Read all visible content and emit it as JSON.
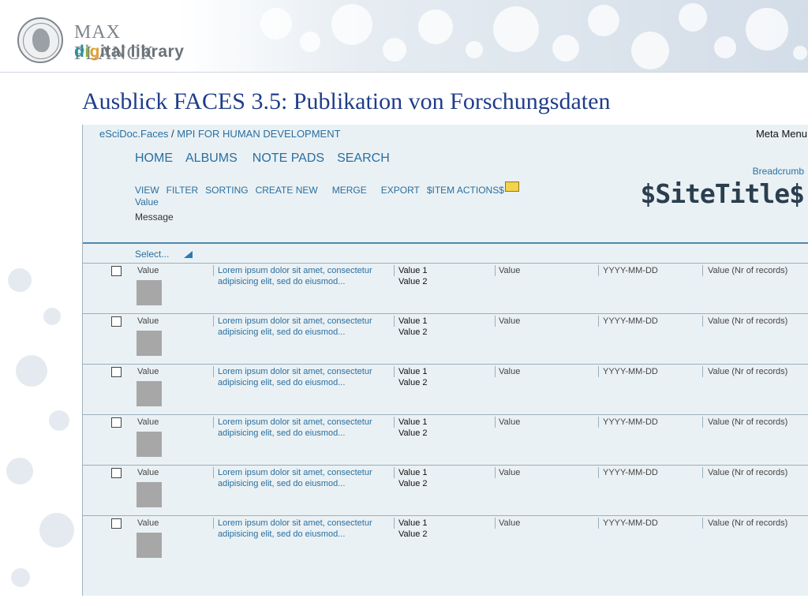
{
  "slide": {
    "logo_line1": "MAX PLANCK",
    "logo_dl_d": "d",
    "logo_dl_i": "i",
    "logo_dl_g": "g",
    "logo_dl_rest": "ital library",
    "title": "Ausblick FACES 3.5: Publikation von Forschungsdaten"
  },
  "header": {
    "app": "eSciDoc.Faces",
    "separator": " / ",
    "institute": "MPI FOR HUMAN DEVELOPMENT",
    "meta_menu": "Meta Menu",
    "breadcrumb": "Breadcrumb",
    "site_title": "$SiteTitle$"
  },
  "main_nav": [
    "HOME",
    "ALBUMS",
    "NOTE PADS",
    "SEARCH"
  ],
  "sub_nav": [
    "VIEW",
    "FILTER",
    "SORTING",
    "CREATE NEW",
    "MERGE",
    "EXPORT",
    "$ITEM ACTIONS$"
  ],
  "value_line": "Value",
  "message_line": "Message",
  "select_label": "Select...",
  "rows": [
    {
      "value": "Value",
      "desc1": "Lorem ipsum dolor sit amet, consectetur",
      "desc2": "adipisicing elit, sed do eiusmod...",
      "v1": "Value 1",
      "v2": "Value 2",
      "value2": "Value",
      "date": "YYYY-MM-DD",
      "nr": "Value (Nr of records)"
    },
    {
      "value": "Value",
      "desc1": "Lorem ipsum dolor sit amet, consectetur",
      "desc2": "adipisicing elit, sed do eiusmod...",
      "v1": "Value 1",
      "v2": "Value 2",
      "value2": "Value",
      "date": "YYYY-MM-DD",
      "nr": "Value (Nr of records)"
    },
    {
      "value": "Value",
      "desc1": "Lorem ipsum dolor sit amet, consectetur",
      "desc2": "adipisicing elit, sed do eiusmod...",
      "v1": "Value 1",
      "v2": "Value 2",
      "value2": "Value",
      "date": "YYYY-MM-DD",
      "nr": "Value (Nr of records)"
    },
    {
      "value": "Value",
      "desc1": "Lorem ipsum dolor sit amet, consectetur",
      "desc2": "adipisicing elit, sed do eiusmod...",
      "v1": "Value 1",
      "v2": "Value 2",
      "value2": "Value",
      "date": "YYYY-MM-DD",
      "nr": "Value (Nr of records)"
    },
    {
      "value": "Value",
      "desc1": "Lorem ipsum dolor sit amet, consectetur",
      "desc2": "adipisicing elit, sed do eiusmod...",
      "v1": "Value 1",
      "v2": "Value 2",
      "value2": "Value",
      "date": "YYYY-MM-DD",
      "nr": "Value (Nr of records)"
    },
    {
      "value": "Value",
      "desc1": "Lorem ipsum dolor sit amet, consectetur",
      "desc2": "adipisicing elit, sed do eiusmod...",
      "v1": "Value 1",
      "v2": "Value 2",
      "value2": "Value",
      "date": "YYYY-MM-DD",
      "nr": "Value (Nr of records)"
    }
  ],
  "colors": {
    "title": "#1f3d8a",
    "link": "#2a6fa0",
    "panel_bg": "#eaf1f4",
    "thumb": "#a7a7a7",
    "note_icon": "#f2d34a"
  },
  "icons": {
    "seal": "max-planck-seal-icon",
    "note": "sticky-note-icon",
    "dropdown": "triangle-icon",
    "checkbox": "checkbox-icon"
  }
}
